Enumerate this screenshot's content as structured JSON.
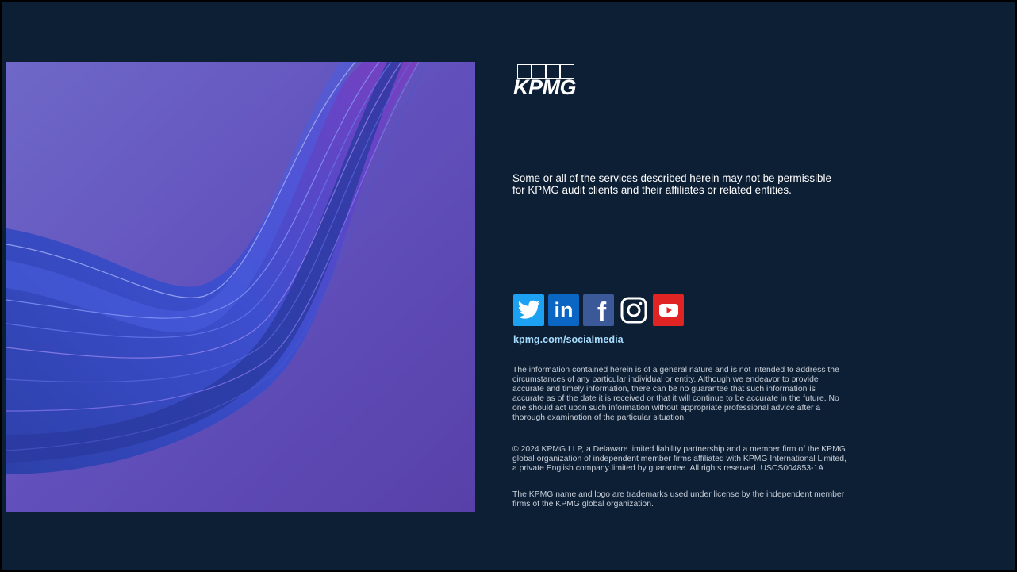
{
  "logo": {
    "text": "KPMG"
  },
  "disclaimer": "Some or all of the services described herein may not be permissible\nfor KPMG audit clients and their affiliates or related entities.",
  "social": {
    "icons": [
      "twitter-icon",
      "linkedin-icon",
      "facebook-icon",
      "instagram-icon",
      "youtube-icon"
    ],
    "colors": {
      "twitter": "#1da1f2",
      "linkedin": "#0a66c2",
      "facebook": "#3b5998",
      "youtube": "#e02424"
    },
    "link_text": "kpmg.com/socialmedia"
  },
  "fine_print": {
    "paragraph1": "The information contained herein is of a general nature and is not intended to address the\ncircumstances of any particular individual or entity. Although we endeavor to provide\naccurate and timely information, there can be no guarantee that such information is\naccurate as of the date it is received or that it will continue to be accurate in the future. No\none should act upon such information without appropriate professional advice after a\nthorough examination of the particular situation.",
    "paragraph2": "© 2024 KPMG LLP, a Delaware limited liability partnership and a member firm of the KPMG\nglobal organization of independent member firms affiliated with KPMG International Limited,\na private English company limited by guarantee. All rights reserved. USCS004853-1A",
    "paragraph3": "The KPMG name and logo are trademarks used under license by the independent member\nfirms of the KPMG global organization."
  },
  "colors": {
    "background": "#0d1f35",
    "hero_purple": "#5a4fb8",
    "link": "#a8dcff"
  }
}
